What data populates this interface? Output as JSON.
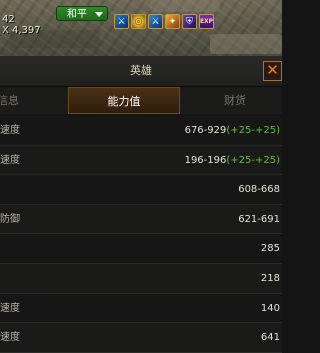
{
  "hud": {
    "coord_top": "42",
    "coord_bottom": "4,397",
    "coord_prefix": "X",
    "mode_label": "和平",
    "buff_icons": [
      "sword-buff-icon",
      "coin-buff-icon",
      "sword-buff-icon",
      "fire-buff-icon",
      "shield-buff-icon",
      "exp-buff-icon"
    ],
    "exp_label": "EXP"
  },
  "window": {
    "title": "英雄",
    "close_label": "✕"
  },
  "tabs": [
    {
      "label": "本信息",
      "active": false
    },
    {
      "label": "能力值",
      "active": true
    },
    {
      "label": "财货",
      "active": false
    }
  ],
  "stats": [
    {
      "label": "速度",
      "value": "676-929",
      "bonus": "(+25-+25)"
    },
    {
      "label": "速度",
      "value": "196-196",
      "bonus": "(+25-+25)"
    },
    {
      "label": "",
      "value": "608-668",
      "bonus": ""
    },
    {
      "label": "防御",
      "value": "621-691",
      "bonus": ""
    },
    {
      "label": "",
      "value": "285",
      "bonus": ""
    },
    {
      "label": "",
      "value": "218",
      "bonus": ""
    },
    {
      "label": "速度",
      "value": "140",
      "bonus": ""
    },
    {
      "label": "速度",
      "value": "641",
      "bonus": ""
    }
  ],
  "colors": {
    "bonus_green": "#5fbf3a",
    "active_tab": "#4a3216",
    "close_orange": "#f07a2a",
    "peace_green": "#2f8a2b"
  }
}
